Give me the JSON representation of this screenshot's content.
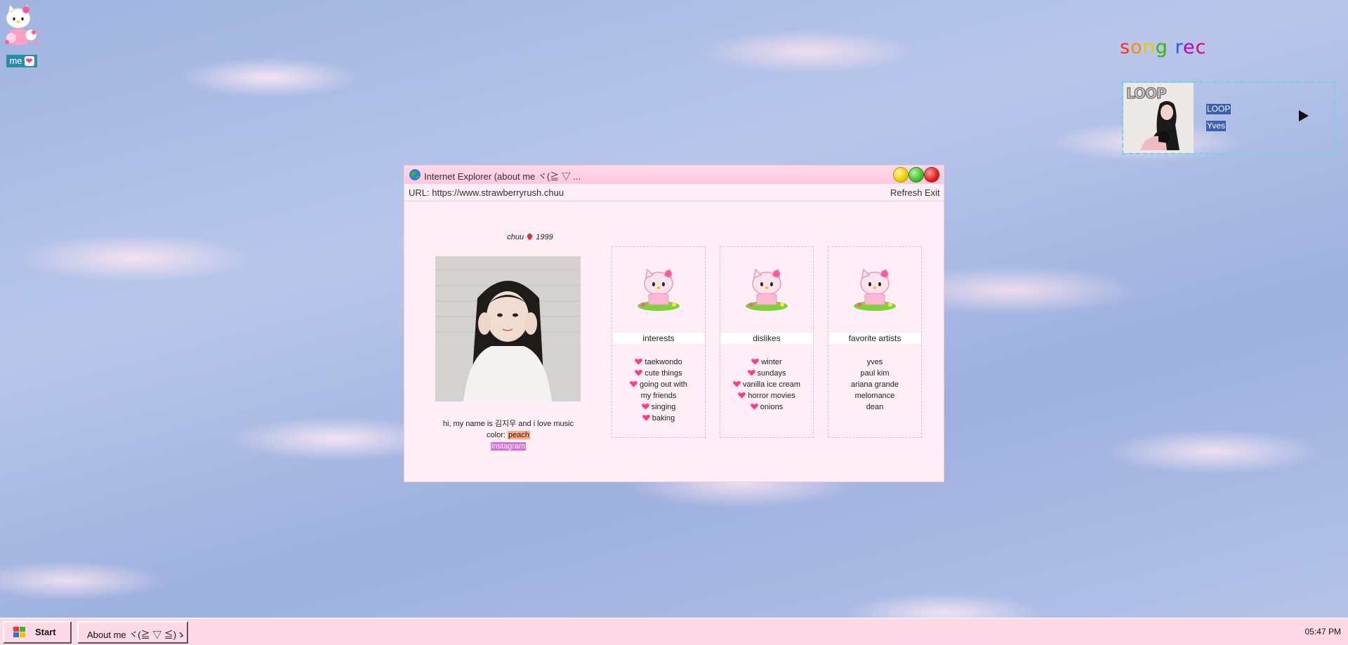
{
  "desktop": {
    "icon_me": {
      "label": "me",
      "icon": "hello-kitty-icon"
    }
  },
  "song_rec": {
    "title_letters": [
      {
        "ch": "s",
        "color": "#ff2a2a"
      },
      {
        "ch": "o",
        "color": "#ff8c00"
      },
      {
        "ch": "n",
        "color": "#f0c400"
      },
      {
        "ch": "g",
        "color": "#3cb400"
      },
      {
        "ch": " ",
        "color": "#000000"
      },
      {
        "ch": "r",
        "color": "#1e5aff"
      },
      {
        "ch": "e",
        "color": "#b000d4"
      },
      {
        "ch": "c",
        "color": "#e0007a"
      }
    ],
    "album_word": "LOOP",
    "song": "LOOP",
    "artist": "Yves",
    "play_icon": "play-icon"
  },
  "window": {
    "title": "Internet Explorer (about me ヾ(≧ ▽ ...",
    "url_label": "URL: https://www.strawberryrush.chuu",
    "refresh_label": "Refresh",
    "exit_label": "Exit"
  },
  "profile": {
    "name": "chuu",
    "year": "1999",
    "bio_line": "hi, my name is 김지우 and i love music",
    "color_label": "color: ",
    "color_value": "peach",
    "instagram": "instagram"
  },
  "cards": [
    {
      "heading": "interests",
      "items": [
        "taekwondo",
        "cute things",
        "going out with",
        "my friends",
        "singing",
        "baking"
      ],
      "bullets": [
        true,
        true,
        true,
        false,
        true,
        true
      ]
    },
    {
      "heading": "dislikes",
      "items": [
        "winter",
        "sundays",
        "vanilla ice cream",
        "horror movies",
        "onions"
      ],
      "bullets": [
        true,
        true,
        true,
        true,
        true
      ]
    },
    {
      "heading": "favorite artists",
      "items": [
        "yves",
        "paul kim",
        "ariana grande",
        "melomance",
        "dean"
      ],
      "bullets": [
        false,
        false,
        false,
        false,
        false
      ]
    }
  ],
  "taskbar": {
    "start_label": "Start",
    "task_label": "About me ヾ(≧ ▽ ≦)ゝ",
    "clock": "05:47 PM"
  },
  "colors": {
    "window_bg": "#ffeef5",
    "titlebar": "#ffd0e3",
    "taskbar": "#ffd9e8",
    "accent_teal": "#2b8ca6",
    "link_purple": "#d66fd9",
    "peach": "#ffa884"
  }
}
